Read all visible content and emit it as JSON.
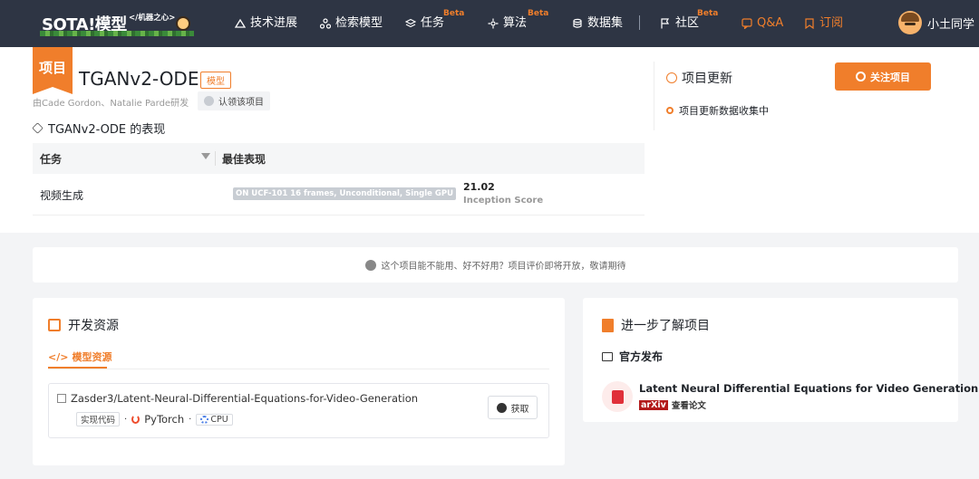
{
  "nav": {
    "logo_main": "SOTA!模型",
    "logo_sub": "</机器之心>",
    "items": [
      {
        "label": "技术进展",
        "icon": "trend-icon"
      },
      {
        "label": "检索模型",
        "icon": "nodes-icon"
      },
      {
        "label": "任务",
        "icon": "layers-icon",
        "badge": "Beta"
      },
      {
        "label": "算法",
        "icon": "algorithm-icon",
        "badge": "Beta"
      },
      {
        "label": "数据集",
        "icon": "database-icon"
      },
      {
        "label": "社区",
        "icon": "flag-icon",
        "badge": "Beta"
      },
      {
        "label": "Q&A",
        "icon": "qa-icon"
      },
      {
        "label": "订阅",
        "icon": "bookmark-icon"
      }
    ],
    "user_name": "小土同学"
  },
  "project": {
    "ribbon": "项目",
    "title": "TGANv2-ODE",
    "type_tag": "模型",
    "authors": "由Cade Gordon、Natalie Parde研发",
    "claim_label": "认领该项目",
    "performance_title": "TGANv2-ODE 的表现",
    "table": {
      "headers": [
        "任务",
        "最佳表现"
      ],
      "rows": [
        {
          "task": "视频生成",
          "badge": "ON UCF-101 16 frames, Unconditional, Single GPU",
          "value": "21.02",
          "metric": "Inception Score"
        }
      ]
    },
    "updates_title": "项目更新",
    "follow_label": "关注项目",
    "update_item": "项目更新数据收集中"
  },
  "notice": "这个项目能不能用、好不好用？项目评价即将开放，敬请期待",
  "dev": {
    "title": "开发资源",
    "tab": "模型资源",
    "repo_name": "Zasder3/Latent-Neural-Differential-Equations-for-Video-Generation",
    "tag_code": "实现代码",
    "framework": "PyTorch",
    "device": "CPU",
    "get_label": "获取"
  },
  "learn": {
    "title": "进一步了解项目",
    "official": "官方发布",
    "paper_title": "Latent Neural Differential Equations for Video Generation",
    "paper_source": "arXiv",
    "paper_action": "查看论文"
  },
  "colors": {
    "accent": "#f07e2b",
    "nav_bg": "#2e3544"
  }
}
